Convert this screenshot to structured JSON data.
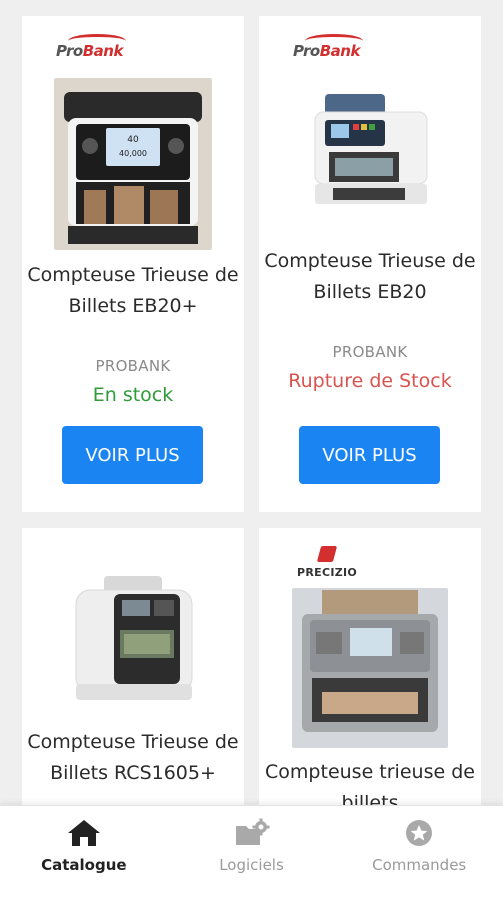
{
  "products": [
    {
      "logo_text": "ProBank",
      "name": "Compteuse Trieuse de Billets EB20+",
      "brand": "PROBANK",
      "stock": "En stock",
      "stock_color": "#2e9c3a",
      "button": "VOIR PLUS",
      "screen": [
        "40",
        "40,000"
      ]
    },
    {
      "logo_text": "ProBank",
      "name": "Compteuse Trieuse de Billets EB20",
      "brand": "PROBANK",
      "stock": "Rupture de Stock",
      "stock_color": "#d9534f",
      "button": "VOIR PLUS"
    },
    {
      "name": "Compteuse Trieuse de Billets RCS1605+"
    },
    {
      "logo_text": "PRECIZIO",
      "name": "Compteuse trieuse de billets"
    }
  ],
  "nav": {
    "items": [
      {
        "label": "Catalogue",
        "icon": "home-icon"
      },
      {
        "label": "Logiciels",
        "icon": "folder-settings-icon"
      },
      {
        "label": "Commandes",
        "icon": "badge-icon"
      }
    ],
    "active": "Catalogue"
  },
  "colors": {
    "accent": "#1a85f2",
    "in_stock": "#2e9c3a",
    "out_of_stock": "#d9534f"
  }
}
